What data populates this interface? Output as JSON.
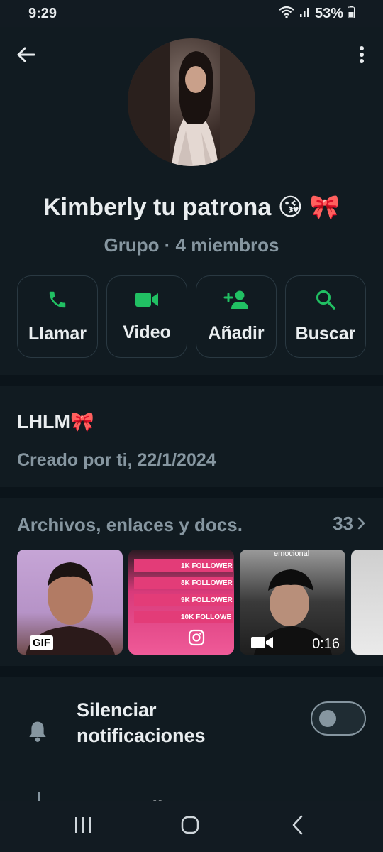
{
  "status_bar": {
    "time": "9:29",
    "battery": "53%"
  },
  "header": {
    "back_icon": "arrow-left-icon",
    "menu_icon": "more-vert-icon"
  },
  "group": {
    "name": "Kimberly tu patrona 😘 🎀",
    "subtitle": "Grupo · 4 miembros"
  },
  "actions": [
    {
      "label": "Llamar",
      "icon": "phone-icon"
    },
    {
      "label": "Video",
      "icon": "video-camera-icon"
    },
    {
      "label": "Añadir",
      "icon": "add-person-icon"
    },
    {
      "label": "Buscar",
      "icon": "search-icon"
    }
  ],
  "description": {
    "title": "LHLM🎀",
    "created": "Creado por ti, 22/1/2024"
  },
  "media": {
    "title": "Archivos, enlaces y docs.",
    "count": "33",
    "thumbs": {
      "gif_badge": "GIF",
      "insta_rows": [
        "1K FOLLOWER",
        "8K FOLLOWER",
        "9K FOLLOWER",
        "10K FOLLOWE"
      ],
      "video_caption": "emocional",
      "video_duration": "0:16"
    }
  },
  "settings": {
    "mute_label": "Silenciar notificaciones",
    "mute_enabled": false,
    "customize_label": "Personalizar"
  },
  "colors": {
    "accent": "#21c063",
    "background": "#0b141a",
    "card": "#111b21",
    "secondary_text": "#8696a0"
  }
}
